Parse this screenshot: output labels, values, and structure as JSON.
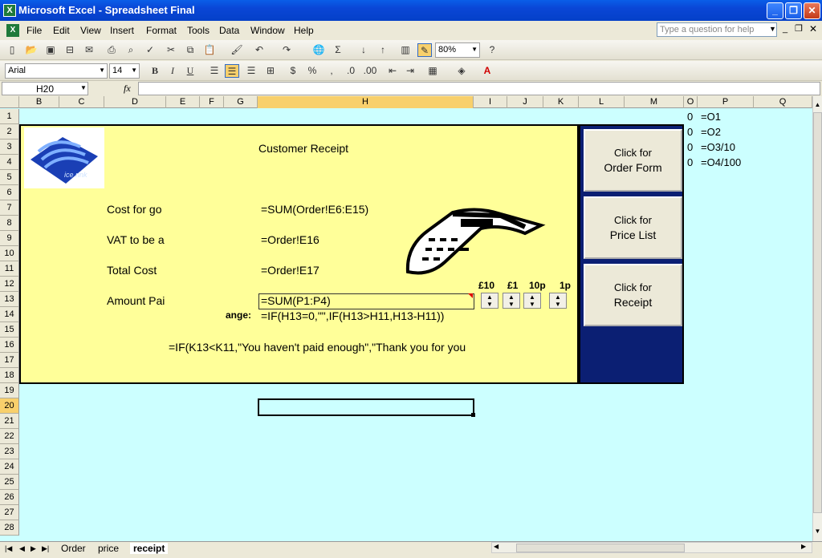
{
  "window": {
    "title": "Microsoft Excel - Spreadsheet Final"
  },
  "menu": [
    "File",
    "Edit",
    "View",
    "Insert",
    "Format",
    "Tools",
    "Data",
    "Window",
    "Help"
  ],
  "help_placeholder": "Type a question for help",
  "toolbar": {
    "zoom": "80%",
    "font_name": "Arial",
    "font_size": "14",
    "bold": "B",
    "italic": "I",
    "underline": "U"
  },
  "formula_bar": {
    "name_box": "H20",
    "fx": "fx",
    "formula": ""
  },
  "columns": [
    "B",
    "C",
    "D",
    "E",
    "F",
    "G",
    "H",
    "I",
    "J",
    "K",
    "L",
    "M",
    "O",
    "P",
    "Q"
  ],
  "selected_column": "H",
  "rows": [
    "1",
    "2",
    "3",
    "4",
    "5",
    "6",
    "7",
    "8",
    "9",
    "10",
    "11",
    "12",
    "13",
    "14",
    "15",
    "16",
    "17",
    "18",
    "19",
    "20",
    "21",
    "22",
    "23",
    "24",
    "25",
    "26",
    "27",
    "28"
  ],
  "selected_row": "20",
  "receipt": {
    "title": "Customer Receipt",
    "logo_text": "ice rink",
    "cost_label": "Cost for go",
    "cost_formula": "=SUM(Order!E6:E15)",
    "vat_label": "VAT to be a",
    "vat_formula": "=Order!E16",
    "total_label": "Total Cost",
    "total_formula": "=Order!E17",
    "paid_label": "Amount Pai",
    "paid_formula": "=SUM(P1:P4)",
    "change_label": "ange:",
    "change_formula": "=IF(H13=0,\"\",IF(H13>H11,H13-H11))",
    "message_formula": "=IF(K13<K11,\"You haven't paid enough\",\"Thank you for you",
    "coins": [
      "£10",
      "£1",
      "10p",
      "1p"
    ]
  },
  "nav_buttons": [
    {
      "line1": "Click for",
      "line2": "Order Form"
    },
    {
      "line1": "Click for",
      "line2": "Price List"
    },
    {
      "line1": "Click for",
      "line2": "Receipt"
    }
  ],
  "side_cells": [
    {
      "o": "0",
      "p": "=O1"
    },
    {
      "o": "0",
      "p": "=O2"
    },
    {
      "o": "0",
      "p": "=O3/10"
    },
    {
      "o": "0",
      "p": "=O4/100"
    }
  ],
  "sheet_tabs": [
    "Order",
    "price",
    "receipt"
  ],
  "active_tab": "receipt"
}
